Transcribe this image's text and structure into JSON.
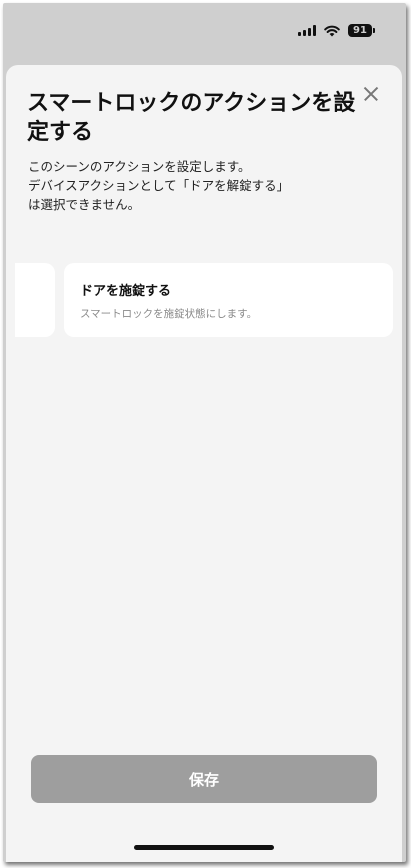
{
  "status_bar": {
    "battery": "91",
    "icons": [
      "signal-icon",
      "wifi-icon",
      "battery-icon"
    ]
  },
  "sheet": {
    "title": "スマートロックのアクションを設定する",
    "description": "このシーンのアクションを設定します。\nデバイスアクションとして「ドアを解錠する」\nは選択できません。",
    "close_icon": "close-icon",
    "action_card": {
      "title": "ドアを施錠する",
      "subtitle": "スマートロックを施錠状態にします。"
    },
    "save_label": "保存"
  },
  "colors": {
    "dim_background": "#cfcfcf",
    "sheet_background": "#f4f4f4",
    "save_button_disabled": "#9e9e9e"
  }
}
